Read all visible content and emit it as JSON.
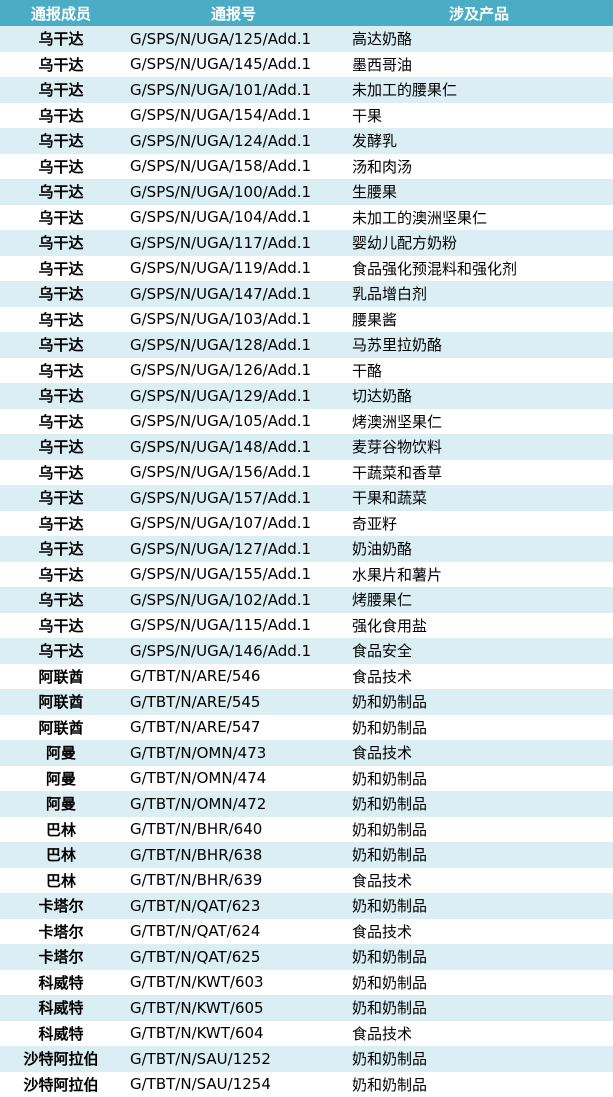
{
  "table": {
    "headers": [
      "通报成员",
      "通报号",
      "涉及产品"
    ],
    "rows": [
      [
        "乌干达",
        "G/SPS/N/UGA/125/Add.1",
        "高达奶酪"
      ],
      [
        "乌干达",
        "G/SPS/N/UGA/145/Add.1",
        "墨西哥油"
      ],
      [
        "乌干达",
        "G/SPS/N/UGA/101/Add.1",
        "未加工的腰果仁"
      ],
      [
        "乌干达",
        "G/SPS/N/UGA/154/Add.1",
        "干果"
      ],
      [
        "乌干达",
        "G/SPS/N/UGA/124/Add.1",
        "发酵乳"
      ],
      [
        "乌干达",
        "G/SPS/N/UGA/158/Add.1",
        "汤和肉汤"
      ],
      [
        "乌干达",
        "G/SPS/N/UGA/100/Add.1",
        "生腰果"
      ],
      [
        "乌干达",
        "G/SPS/N/UGA/104/Add.1",
        "未加工的澳洲坚果仁"
      ],
      [
        "乌干达",
        "G/SPS/N/UGA/117/Add.1",
        "婴幼儿配方奶粉"
      ],
      [
        "乌干达",
        "G/SPS/N/UGA/119/Add.1",
        "食品强化预混料和强化剂"
      ],
      [
        "乌干达",
        "G/SPS/N/UGA/147/Add.1",
        "乳品增白剂"
      ],
      [
        "乌干达",
        "G/SPS/N/UGA/103/Add.1",
        "腰果酱"
      ],
      [
        "乌干达",
        "G/SPS/N/UGA/128/Add.1",
        "马苏里拉奶酪"
      ],
      [
        "乌干达",
        "G/SPS/N/UGA/126/Add.1",
        "干酪"
      ],
      [
        "乌干达",
        "G/SPS/N/UGA/129/Add.1",
        "切达奶酪"
      ],
      [
        "乌干达",
        "G/SPS/N/UGA/105/Add.1",
        "烤澳洲坚果仁"
      ],
      [
        "乌干达",
        "G/SPS/N/UGA/148/Add.1",
        "麦芽谷物饮料"
      ],
      [
        "乌干达",
        "G/SPS/N/UGA/156/Add.1",
        "干蔬菜和香草"
      ],
      [
        "乌干达",
        "G/SPS/N/UGA/157/Add.1",
        "干果和蔬菜"
      ],
      [
        "乌干达",
        "G/SPS/N/UGA/107/Add.1",
        "奇亚籽"
      ],
      [
        "乌干达",
        "G/SPS/N/UGA/127/Add.1",
        "奶油奶酪"
      ],
      [
        "乌干达",
        "G/SPS/N/UGA/155/Add.1",
        "水果片和薯片"
      ],
      [
        "乌干达",
        "G/SPS/N/UGA/102/Add.1",
        "烤腰果仁"
      ],
      [
        "乌干达",
        "G/SPS/N/UGA/115/Add.1",
        "强化食用盐"
      ],
      [
        "乌干达",
        "G/SPS/N/UGA/146/Add.1",
        "食品安全"
      ],
      [
        "阿联酋",
        "G/TBT/N/ARE/546",
        "食品技术"
      ],
      [
        "阿联酋",
        "G/TBT/N/ARE/545",
        "奶和奶制品"
      ],
      [
        "阿联酋",
        "G/TBT/N/ARE/547",
        "奶和奶制品"
      ],
      [
        "阿曼",
        "G/TBT/N/OMN/473",
        "食品技术"
      ],
      [
        "阿曼",
        "G/TBT/N/OMN/474",
        "奶和奶制品"
      ],
      [
        "阿曼",
        "G/TBT/N/OMN/472",
        "奶和奶制品"
      ],
      [
        "巴林",
        "G/TBT/N/BHR/640",
        "奶和奶制品"
      ],
      [
        "巴林",
        "G/TBT/N/BHR/638",
        "奶和奶制品"
      ],
      [
        "巴林",
        "G/TBT/N/BHR/639",
        "食品技术"
      ],
      [
        "卡塔尔",
        "G/TBT/N/QAT/623",
        "奶和奶制品"
      ],
      [
        "卡塔尔",
        "G/TBT/N/QAT/624",
        "食品技术"
      ],
      [
        "卡塔尔",
        "G/TBT/N/QAT/625",
        "奶和奶制品"
      ],
      [
        "科威特",
        "G/TBT/N/KWT/603",
        "奶和奶制品"
      ],
      [
        "科威特",
        "G/TBT/N/KWT/605",
        "奶和奶制品"
      ],
      [
        "科威特",
        "G/TBT/N/KWT/604",
        "食品技术"
      ],
      [
        "沙特阿拉伯",
        "G/TBT/N/SAU/1252",
        "奶和奶制品"
      ],
      [
        "沙特阿拉伯",
        "G/TBT/N/SAU/1254",
        "奶和奶制品"
      ]
    ]
  },
  "colors": {
    "header_bg": "#4bacc6",
    "header_text": "#ffffff",
    "stripe_bg": "#daeef3",
    "row_bg": "#ffffff"
  }
}
